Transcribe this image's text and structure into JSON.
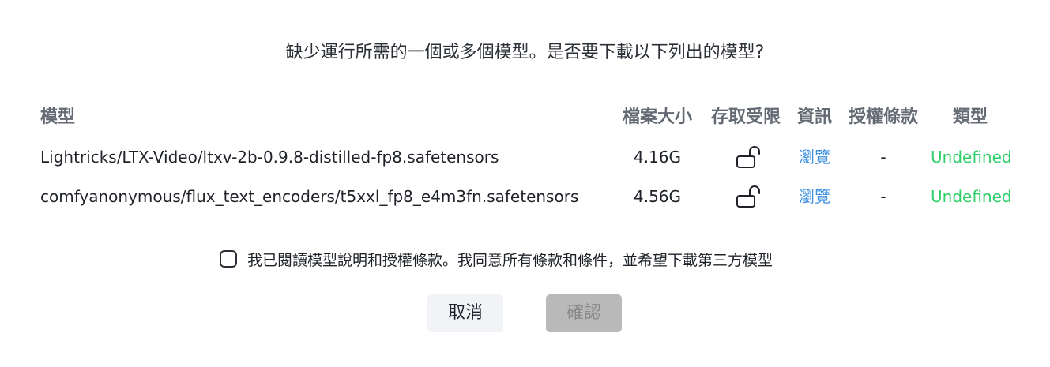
{
  "dialog": {
    "message": "缺少運行所需的一個或多個模型。是否要下載以下列出的模型?",
    "columns": {
      "model": "模型",
      "size": "檔案大小",
      "access": "存取受限",
      "info": "資訊",
      "license": "授權條款",
      "type": "類型"
    },
    "rows": [
      {
        "model": "Lightricks/LTX-Video/ltxv-2b-0.9.8-distilled-fp8.safetensors",
        "size": "4.16G",
        "access_icon": "unlocked-padlock-icon",
        "info": "瀏覽",
        "license": "-",
        "type": "Undefined"
      },
      {
        "model": "comfyanonymous/flux_text_encoders/t5xxl_fp8_e4m3fn.safetensors",
        "size": "4.56G",
        "access_icon": "unlocked-padlock-icon",
        "info": "瀏覽",
        "license": "-",
        "type": "Undefined"
      }
    ],
    "agreement": "我已閱讀模型說明和授權條款。我同意所有條款和條件，並希望下載第三方模型",
    "agreement_checked": false,
    "cancel_label": "取消",
    "confirm_label": "確認",
    "colors": {
      "link": "#3b8fe0",
      "type_undefined": "#2fcf6a",
      "header_text": "#646a73",
      "confirm_disabled_bg": "#b9b9b9",
      "cancel_bg": "#f1f3f7"
    }
  }
}
